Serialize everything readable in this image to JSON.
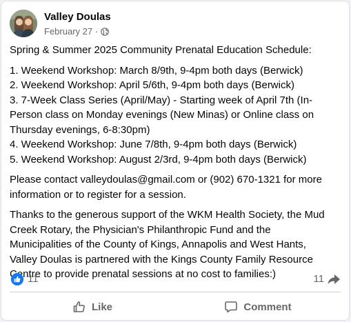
{
  "post": {
    "author": "Valley Doulas",
    "date": "February 27",
    "separator": "·",
    "audience_icon": "globe-icon",
    "lines": [
      [
        "Spring & Summer 2025 Community Prenatal Education Schedule:"
      ],
      [
        "1. Weekend Workshop: March 8/9th, 9-4pm both days (Berwick)",
        "2. Weekend Workshop: April 5/6th, 9-4pm both days (Berwick)",
        "3. 7-Week Class Series (April/May) - Starting week of April 7th (In-",
        "Person class on Monday evenings (New Minas) or Online class on",
        "Thursday evenings, 6-8:30pm)",
        "4. Weekend Workshop: June 7/8th, 9-4pm both days (Berwick)",
        "5. Weekend Workshop: August 2/3rd, 9-4pm both days (Berwick)"
      ],
      [
        "Please contact valleydoulas@gmail.com or (902) 670-1321 for more",
        "information or to register for a session."
      ],
      [
        "Thanks to the generous support of the WKM Health Society, the Mud",
        "Creek Rotary, the Physician's Philanthropic Fund and the",
        "Municipalities of the County of Kings, Annapolis and West Hants,",
        "Valley Doulas is partnered with the Kings County Family Resource",
        "Centre to provide prenatal sessions at no cost to families:)"
      ]
    ]
  },
  "reactions": {
    "like_count": "11",
    "share_count": "11",
    "like_icon": "thumbs-up-icon",
    "share_icon": "share-arrow-icon"
  },
  "actions": {
    "like_label": "Like",
    "comment_label": "Comment"
  },
  "colors": {
    "accent": "#1877f2",
    "secondary_text": "#65676b",
    "background": "#f0f2f5"
  }
}
